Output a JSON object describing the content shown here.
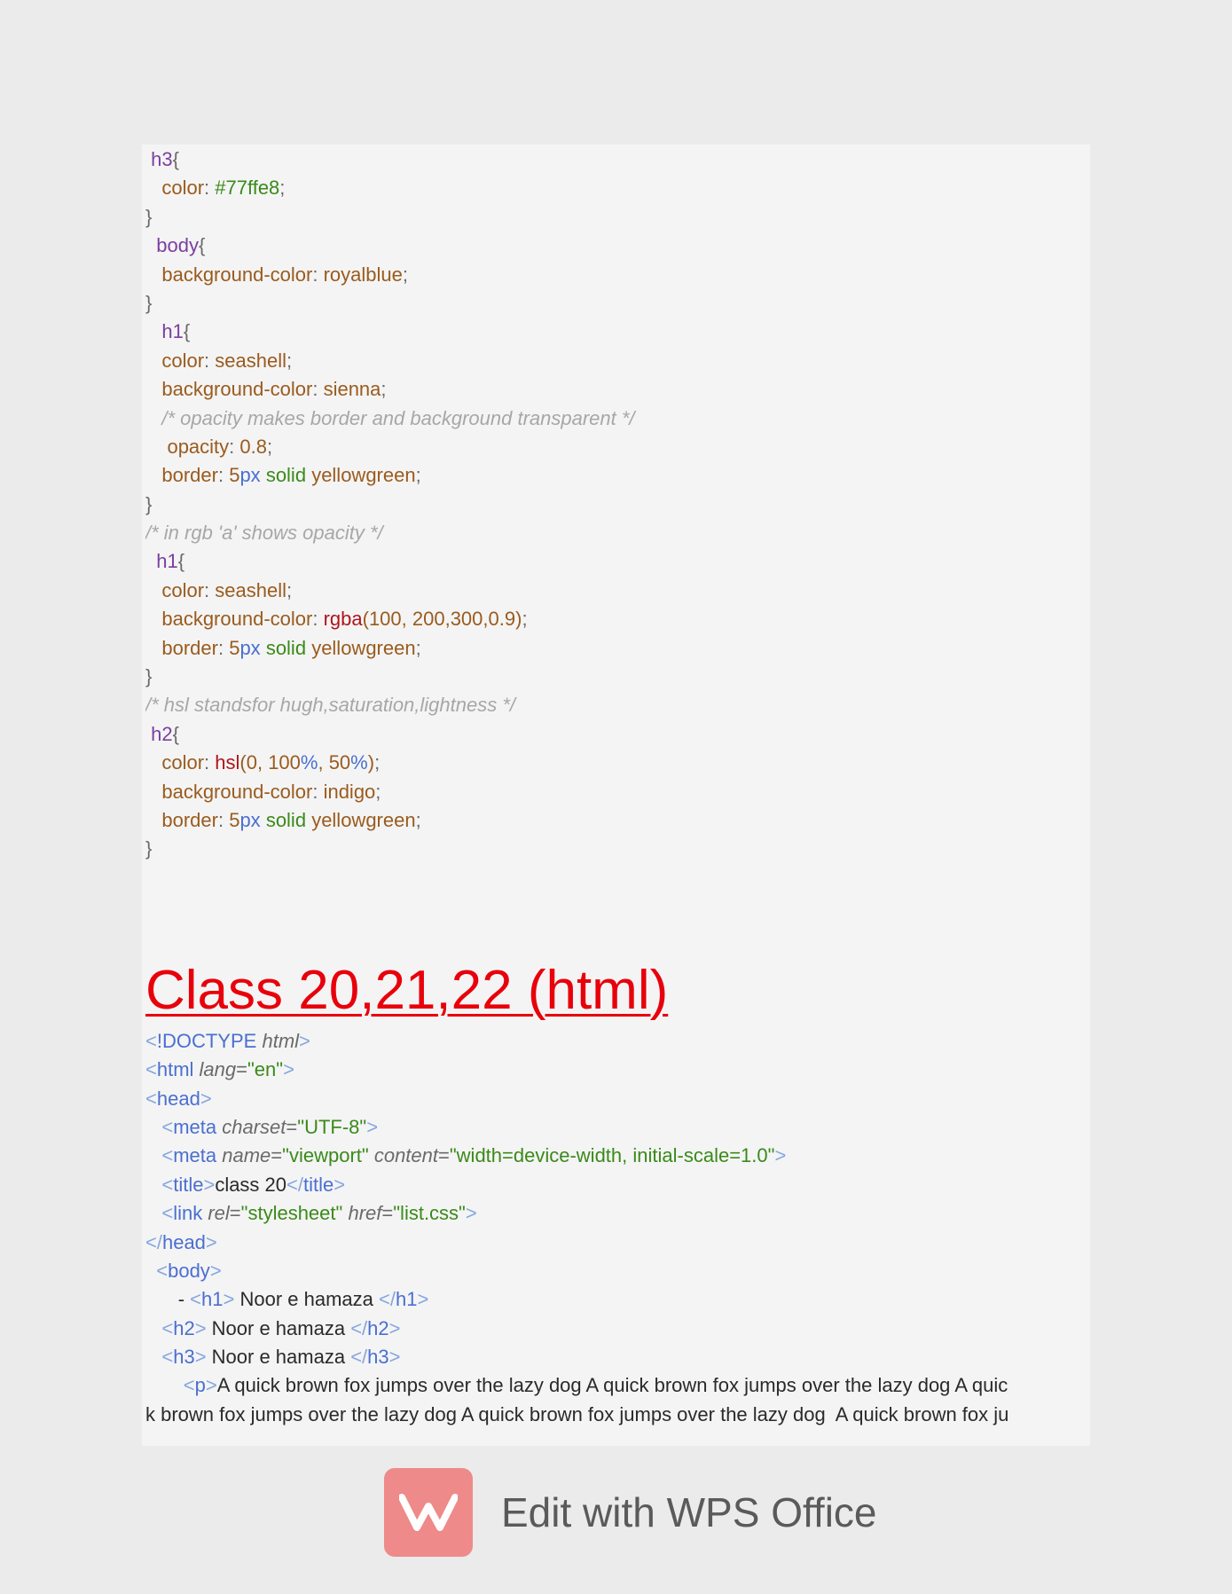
{
  "css_code": {
    "h3": "h3",
    "color": "color",
    "colon": ":",
    "semi": ";",
    "brace_open": "{",
    "brace_close": "}",
    "hex_777ffe8": "#77ffe8",
    "body": "body",
    "background_color": "background-color",
    "royalblue": "royalblue",
    "h1": "h1",
    "seashell": "seashell",
    "sienna": "sienna",
    "comment_opacity": "/* opacity makes border and background transparent */",
    "opacity": "opacity",
    "opacity_val": "0.8",
    "border": "border",
    "five": "5",
    "px": "px",
    "solid": "solid",
    "yellowgreen": "yellowgreen",
    "comment_rgb": "/* in rgb 'a' shows opacity */",
    "rgba": "rgba",
    "rgba_args": "(100, 200,300,0.9)",
    "comment_hsl": "/* hsl standsfor hugh,saturation,lightness */",
    "h2": "h2",
    "hsl": "hsl",
    "hsl_open": "(0, 100",
    "pct": "%",
    "hsl_mid": ", 50",
    "hsl_close": ")",
    "indigo": "indigo"
  },
  "heading": "Class 20,21,22 (html)",
  "html_code": {
    "lt": "<",
    "gt": ">",
    "lt_slash": "</",
    "bang": "!",
    "doctype": "DOCTYPE",
    "html_attr": "html",
    "html": "html",
    "lang": "lang",
    "eq": "=",
    "en": "\"en\"",
    "head": "head",
    "meta": "meta",
    "charset": "charset",
    "utf8": "\"UTF-8\"",
    "name": "name",
    "viewport": "\"viewport\"",
    "content": "content",
    "content_val": "\"width=device-width, initial-scale=1.0\"",
    "title": "title",
    "title_text": "class 20",
    "link": "link",
    "rel": "rel",
    "stylesheet": "\"stylesheet\"",
    "href": "href",
    "list_css": "\"list.css\"",
    "body": "body",
    "dash": "- ",
    "h1": "h1",
    "h2": "h2",
    "h3": "h3",
    "noor": " Noor e hamaza ",
    "p": "p",
    "p_text_1": "A quick brown fox jumps over the lazy dog A quick brown fox jumps over the lazy dog A quic",
    "p_text_2": "k brown fox jumps over the lazy dog A quick brown fox jumps over the lazy dog  A quick brown fox ju"
  },
  "watermark": {
    "text": "Edit with WPS Office",
    "logo_color": "#ee8a89"
  },
  "colors": {
    "heading": "#e8000b",
    "page_background": "#f4f4f4",
    "outer_background": "#ebebeb"
  }
}
